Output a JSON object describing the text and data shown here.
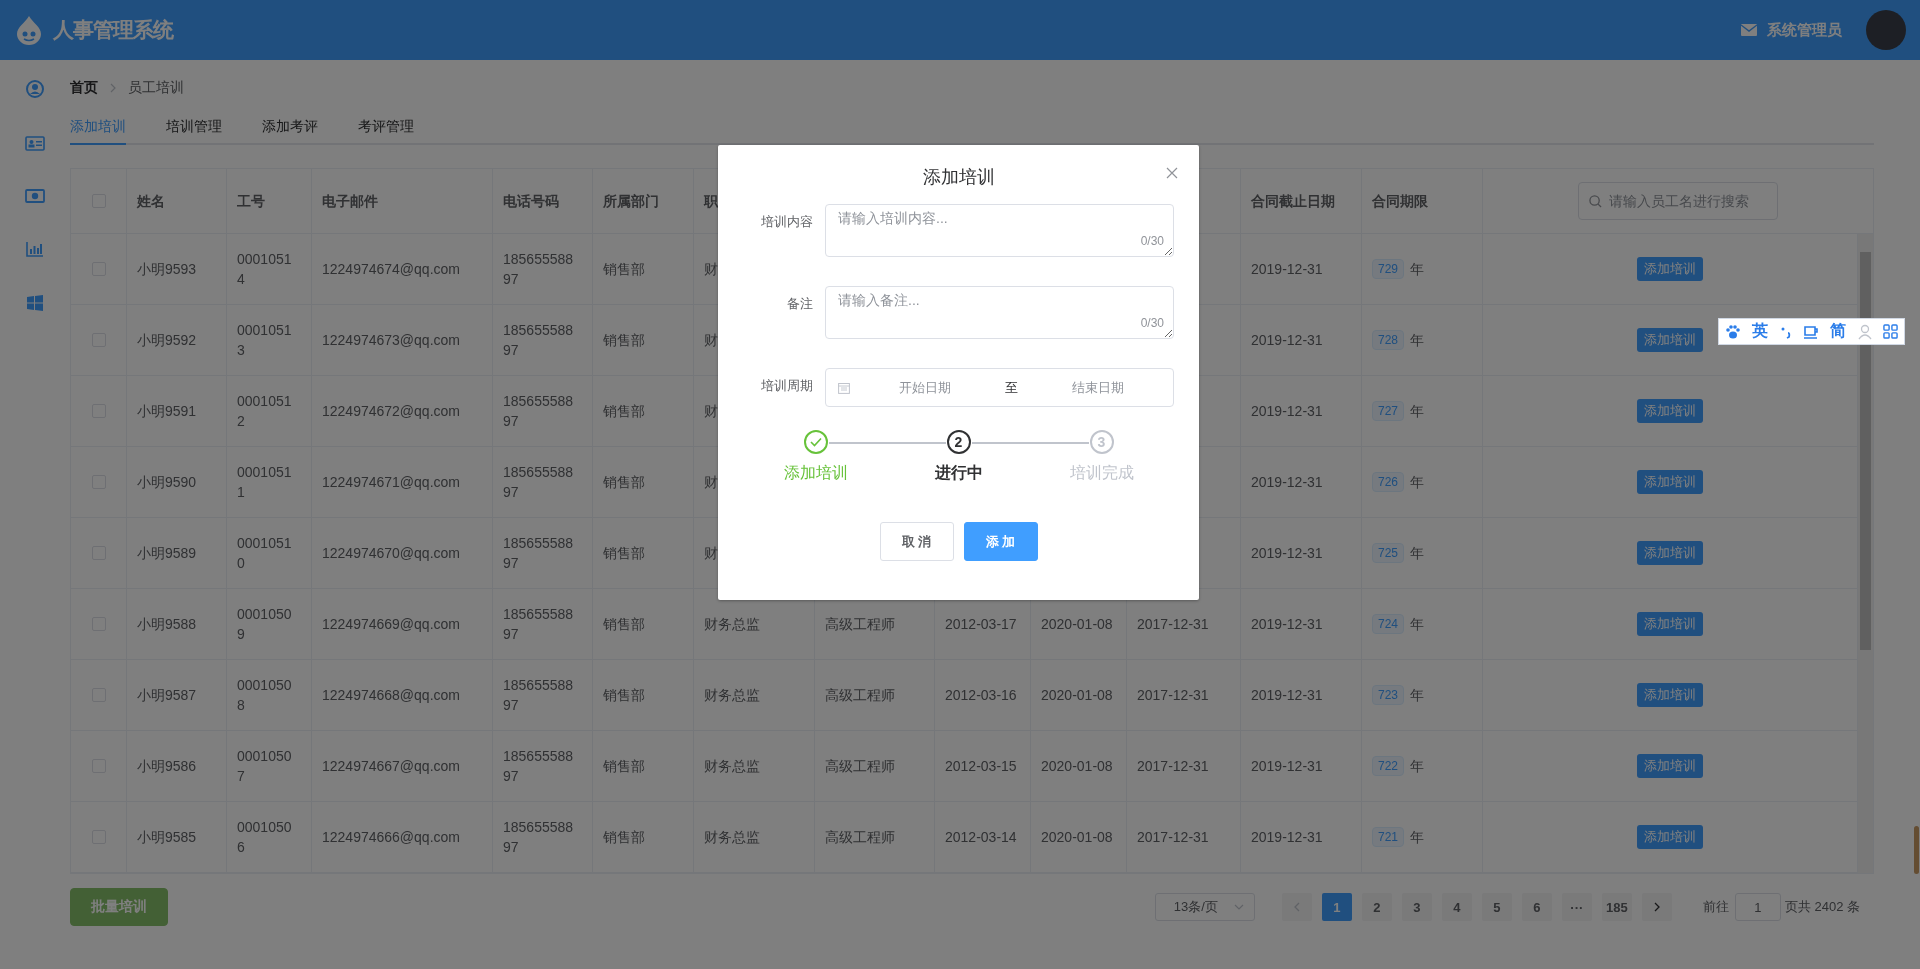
{
  "header": {
    "app_title": "人事管理系统",
    "username": "系统管理员"
  },
  "breadcrumb": [
    {
      "label": "首页",
      "link": true
    },
    {
      "label": "员工培训",
      "link": false
    }
  ],
  "tabs": [
    {
      "label": "添加培训",
      "selected": true
    },
    {
      "label": "培训管理",
      "selected": false
    },
    {
      "label": "添加考评",
      "selected": false
    },
    {
      "label": "考评管理",
      "selected": false
    }
  ],
  "table": {
    "select_all": {
      "checked": false
    },
    "columns": [
      "姓名",
      "工号",
      "电子邮件",
      "电话号码",
      "所属部门",
      "职",
      null,
      null,
      null,
      null,
      "合同截止日期",
      "合同期限"
    ],
    "search": {
      "placeholder": "请输入员工名进行搜索"
    },
    "rows": [
      {
        "checked": false,
        "cells": [
          "小明9593",
          "00010514",
          "1224974674@qq.com",
          "18565558897",
          "销售部",
          "财",
          null,
          null,
          null,
          null,
          "2019-12-31"
        ],
        "term": "729",
        "term_unit": "年",
        "action": "添加培训"
      },
      {
        "checked": false,
        "cells": [
          "小明9592",
          "00010513",
          "1224974673@qq.com",
          "18565558897",
          "销售部",
          "财",
          null,
          null,
          null,
          null,
          "2019-12-31"
        ],
        "term": "728",
        "term_unit": "年",
        "action": "添加培训"
      },
      {
        "checked": false,
        "cells": [
          "小明9591",
          "00010512",
          "1224974672@qq.com",
          "18565558897",
          "销售部",
          "财",
          null,
          null,
          null,
          null,
          "2019-12-31"
        ],
        "term": "727",
        "term_unit": "年",
        "action": "添加培训"
      },
      {
        "checked": false,
        "cells": [
          "小明9590",
          "00010511",
          "1224974671@qq.com",
          "18565558897",
          "销售部",
          "财",
          null,
          null,
          null,
          null,
          "2019-12-31"
        ],
        "term": "726",
        "term_unit": "年",
        "action": "添加培训"
      },
      {
        "checked": false,
        "cells": [
          "小明9589",
          "00010510",
          "1224974670@qq.com",
          "18565558897",
          "销售部",
          "财",
          null,
          null,
          null,
          null,
          "2019-12-31"
        ],
        "term": "725",
        "term_unit": "年",
        "action": "添加培训"
      },
      {
        "checked": false,
        "cells": [
          "小明9588",
          "00010509",
          "1224974669@qq.com",
          "18565558897",
          "销售部",
          "财务总监",
          "高级工程师",
          "2012-03-17",
          "2020-01-08",
          "2017-12-31",
          "2019-12-31"
        ],
        "term": "724",
        "term_unit": "年",
        "action": "添加培训"
      },
      {
        "checked": false,
        "cells": [
          "小明9587",
          "00010508",
          "1224974668@qq.com",
          "18565558897",
          "销售部",
          "财务总监",
          "高级工程师",
          "2012-03-16",
          "2020-01-08",
          "2017-12-31",
          "2019-12-31"
        ],
        "term": "723",
        "term_unit": "年",
        "action": "添加培训"
      },
      {
        "checked": false,
        "cells": [
          "小明9586",
          "00010507",
          "1224974667@qq.com",
          "18565558897",
          "销售部",
          "财务总监",
          "高级工程师",
          "2012-03-15",
          "2020-01-08",
          "2017-12-31",
          "2019-12-31"
        ],
        "term": "722",
        "term_unit": "年",
        "action": "添加培训"
      },
      {
        "checked": false,
        "cells": [
          "小明9585",
          "00010506",
          "1224974666@qq.com",
          "18565558897",
          "销售部",
          "财务总监",
          "高级工程师",
          "2012-03-14",
          "2020-01-08",
          "2017-12-31",
          "2019-12-31"
        ],
        "term": "721",
        "term_unit": "年",
        "action": "添加培训"
      }
    ]
  },
  "batch_button": {
    "label": "批量培训",
    "disabled": true
  },
  "pagination": {
    "page_size": "13条/页",
    "prev_disabled": true,
    "next_disabled": false,
    "pages": [
      {
        "label": "1",
        "selected": true
      },
      {
        "label": "2",
        "selected": false
      },
      {
        "label": "3",
        "selected": false
      },
      {
        "label": "4",
        "selected": false
      },
      {
        "label": "5",
        "selected": false
      },
      {
        "label": "6",
        "selected": false
      },
      {
        "label": "···",
        "selected": false
      },
      {
        "label": "185",
        "selected": false
      }
    ],
    "goto_label": "前往",
    "goto_value": "1",
    "page_suffix": "页",
    "total": "共 2402 条"
  },
  "dialog": {
    "title": "添加培训",
    "fields": [
      {
        "kind": "textarea",
        "label": "培训内容",
        "placeholder": "请输入培训内容...",
        "counter": "0/30"
      },
      {
        "kind": "textarea",
        "label": "备注",
        "placeholder": "请输入备注...",
        "counter": "0/30"
      },
      {
        "kind": "daterange",
        "label": "培训周期",
        "start_placeholder": "开始日期",
        "separator": "至",
        "end_placeholder": "结束日期"
      }
    ],
    "steps": [
      {
        "label": "添加培训",
        "finished": true,
        "active": false
      },
      {
        "label": "进行中",
        "finished": false,
        "active": true,
        "number": "2"
      },
      {
        "label": "培训完成",
        "finished": false,
        "active": false,
        "number": "3"
      }
    ],
    "buttons": [
      {
        "label": "取 消",
        "kind": "default"
      },
      {
        "label": "添 加",
        "kind": "primary"
      }
    ]
  },
  "ime_toolbar": {
    "items": [
      {
        "kind": "paw"
      },
      {
        "kind": "text",
        "label": "英"
      },
      {
        "kind": "punct"
      },
      {
        "kind": "cup"
      },
      {
        "kind": "text",
        "label": "简"
      },
      {
        "kind": "person"
      },
      {
        "kind": "grid"
      }
    ]
  }
}
